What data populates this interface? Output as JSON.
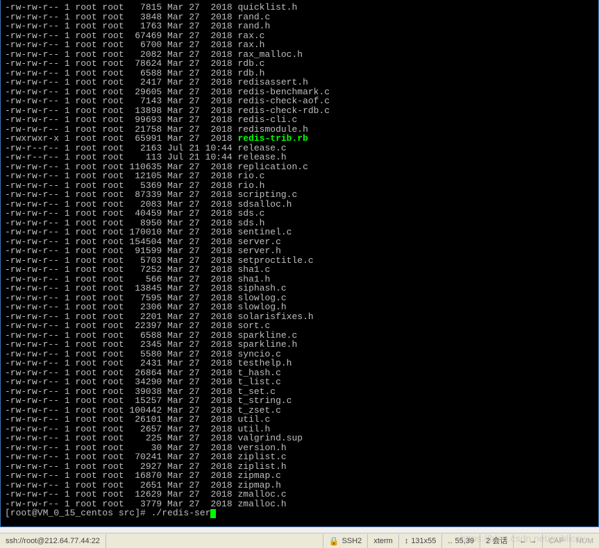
{
  "files": [
    {
      "perm": "-rw-rw-r--",
      "links": "1",
      "owner": "root",
      "group": "root",
      "size": "7815",
      "month": "Mar",
      "day": "27",
      "time": "2018",
      "name": "quicklist.h"
    },
    {
      "perm": "-rw-rw-r--",
      "links": "1",
      "owner": "root",
      "group": "root",
      "size": "3848",
      "month": "Mar",
      "day": "27",
      "time": "2018",
      "name": "rand.c"
    },
    {
      "perm": "-rw-rw-r--",
      "links": "1",
      "owner": "root",
      "group": "root",
      "size": "1763",
      "month": "Mar",
      "day": "27",
      "time": "2018",
      "name": "rand.h"
    },
    {
      "perm": "-rw-rw-r--",
      "links": "1",
      "owner": "root",
      "group": "root",
      "size": "67469",
      "month": "Mar",
      "day": "27",
      "time": "2018",
      "name": "rax.c"
    },
    {
      "perm": "-rw-rw-r--",
      "links": "1",
      "owner": "root",
      "group": "root",
      "size": "6700",
      "month": "Mar",
      "day": "27",
      "time": "2018",
      "name": "rax.h"
    },
    {
      "perm": "-rw-rw-r--",
      "links": "1",
      "owner": "root",
      "group": "root",
      "size": "2082",
      "month": "Mar",
      "day": "27",
      "time": "2018",
      "name": "rax_malloc.h"
    },
    {
      "perm": "-rw-rw-r--",
      "links": "1",
      "owner": "root",
      "group": "root",
      "size": "78624",
      "month": "Mar",
      "day": "27",
      "time": "2018",
      "name": "rdb.c"
    },
    {
      "perm": "-rw-rw-r--",
      "links": "1",
      "owner": "root",
      "group": "root",
      "size": "6588",
      "month": "Mar",
      "day": "27",
      "time": "2018",
      "name": "rdb.h"
    },
    {
      "perm": "-rw-rw-r--",
      "links": "1",
      "owner": "root",
      "group": "root",
      "size": "2417",
      "month": "Mar",
      "day": "27",
      "time": "2018",
      "name": "redisassert.h"
    },
    {
      "perm": "-rw-rw-r--",
      "links": "1",
      "owner": "root",
      "group": "root",
      "size": "29605",
      "month": "Mar",
      "day": "27",
      "time": "2018",
      "name": "redis-benchmark.c"
    },
    {
      "perm": "-rw-rw-r--",
      "links": "1",
      "owner": "root",
      "group": "root",
      "size": "7143",
      "month": "Mar",
      "day": "27",
      "time": "2018",
      "name": "redis-check-aof.c"
    },
    {
      "perm": "-rw-rw-r--",
      "links": "1",
      "owner": "root",
      "group": "root",
      "size": "13898",
      "month": "Mar",
      "day": "27",
      "time": "2018",
      "name": "redis-check-rdb.c"
    },
    {
      "perm": "-rw-rw-r--",
      "links": "1",
      "owner": "root",
      "group": "root",
      "size": "99693",
      "month": "Mar",
      "day": "27",
      "time": "2018",
      "name": "redis-cli.c"
    },
    {
      "perm": "-rw-rw-r--",
      "links": "1",
      "owner": "root",
      "group": "root",
      "size": "21758",
      "month": "Mar",
      "day": "27",
      "time": "2018",
      "name": "redismodule.h"
    },
    {
      "perm": "-rwxrwxr-x",
      "links": "1",
      "owner": "root",
      "group": "root",
      "size": "65991",
      "month": "Mar",
      "day": "27",
      "time": "2018",
      "name": "redis-trib.rb",
      "exec": true
    },
    {
      "perm": "-rw-r--r--",
      "links": "1",
      "owner": "root",
      "group": "root",
      "size": "2163",
      "month": "Jul",
      "day": "21",
      "time": "10:44",
      "name": "release.c"
    },
    {
      "perm": "-rw-r--r--",
      "links": "1",
      "owner": "root",
      "group": "root",
      "size": "113",
      "month": "Jul",
      "day": "21",
      "time": "10:44",
      "name": "release.h"
    },
    {
      "perm": "-rw-rw-r--",
      "links": "1",
      "owner": "root",
      "group": "root",
      "size": "110635",
      "month": "Mar",
      "day": "27",
      "time": "2018",
      "name": "replication.c"
    },
    {
      "perm": "-rw-rw-r--",
      "links": "1",
      "owner": "root",
      "group": "root",
      "size": "12105",
      "month": "Mar",
      "day": "27",
      "time": "2018",
      "name": "rio.c"
    },
    {
      "perm": "-rw-rw-r--",
      "links": "1",
      "owner": "root",
      "group": "root",
      "size": "5369",
      "month": "Mar",
      "day": "27",
      "time": "2018",
      "name": "rio.h"
    },
    {
      "perm": "-rw-rw-r--",
      "links": "1",
      "owner": "root",
      "group": "root",
      "size": "87339",
      "month": "Mar",
      "day": "27",
      "time": "2018",
      "name": "scripting.c"
    },
    {
      "perm": "-rw-rw-r--",
      "links": "1",
      "owner": "root",
      "group": "root",
      "size": "2083",
      "month": "Mar",
      "day": "27",
      "time": "2018",
      "name": "sdsalloc.h"
    },
    {
      "perm": "-rw-rw-r--",
      "links": "1",
      "owner": "root",
      "group": "root",
      "size": "40459",
      "month": "Mar",
      "day": "27",
      "time": "2018",
      "name": "sds.c"
    },
    {
      "perm": "-rw-rw-r--",
      "links": "1",
      "owner": "root",
      "group": "root",
      "size": "8950",
      "month": "Mar",
      "day": "27",
      "time": "2018",
      "name": "sds.h"
    },
    {
      "perm": "-rw-rw-r--",
      "links": "1",
      "owner": "root",
      "group": "root",
      "size": "170010",
      "month": "Mar",
      "day": "27",
      "time": "2018",
      "name": "sentinel.c"
    },
    {
      "perm": "-rw-rw-r--",
      "links": "1",
      "owner": "root",
      "group": "root",
      "size": "154504",
      "month": "Mar",
      "day": "27",
      "time": "2018",
      "name": "server.c"
    },
    {
      "perm": "-rw-rw-r--",
      "links": "1",
      "owner": "root",
      "group": "root",
      "size": "91599",
      "month": "Mar",
      "day": "27",
      "time": "2018",
      "name": "server.h"
    },
    {
      "perm": "-rw-rw-r--",
      "links": "1",
      "owner": "root",
      "group": "root",
      "size": "5703",
      "month": "Mar",
      "day": "27",
      "time": "2018",
      "name": "setproctitle.c"
    },
    {
      "perm": "-rw-rw-r--",
      "links": "1",
      "owner": "root",
      "group": "root",
      "size": "7252",
      "month": "Mar",
      "day": "27",
      "time": "2018",
      "name": "sha1.c"
    },
    {
      "perm": "-rw-rw-r--",
      "links": "1",
      "owner": "root",
      "group": "root",
      "size": "566",
      "month": "Mar",
      "day": "27",
      "time": "2018",
      "name": "sha1.h"
    },
    {
      "perm": "-rw-rw-r--",
      "links": "1",
      "owner": "root",
      "group": "root",
      "size": "13845",
      "month": "Mar",
      "day": "27",
      "time": "2018",
      "name": "siphash.c"
    },
    {
      "perm": "-rw-rw-r--",
      "links": "1",
      "owner": "root",
      "group": "root",
      "size": "7595",
      "month": "Mar",
      "day": "27",
      "time": "2018",
      "name": "slowlog.c"
    },
    {
      "perm": "-rw-rw-r--",
      "links": "1",
      "owner": "root",
      "group": "root",
      "size": "2306",
      "month": "Mar",
      "day": "27",
      "time": "2018",
      "name": "slowlog.h"
    },
    {
      "perm": "-rw-rw-r--",
      "links": "1",
      "owner": "root",
      "group": "root",
      "size": "2201",
      "month": "Mar",
      "day": "27",
      "time": "2018",
      "name": "solarisfixes.h"
    },
    {
      "perm": "-rw-rw-r--",
      "links": "1",
      "owner": "root",
      "group": "root",
      "size": "22397",
      "month": "Mar",
      "day": "27",
      "time": "2018",
      "name": "sort.c"
    },
    {
      "perm": "-rw-rw-r--",
      "links": "1",
      "owner": "root",
      "group": "root",
      "size": "6588",
      "month": "Mar",
      "day": "27",
      "time": "2018",
      "name": "sparkline.c"
    },
    {
      "perm": "-rw-rw-r--",
      "links": "1",
      "owner": "root",
      "group": "root",
      "size": "2345",
      "month": "Mar",
      "day": "27",
      "time": "2018",
      "name": "sparkline.h"
    },
    {
      "perm": "-rw-rw-r--",
      "links": "1",
      "owner": "root",
      "group": "root",
      "size": "5580",
      "month": "Mar",
      "day": "27",
      "time": "2018",
      "name": "syncio.c"
    },
    {
      "perm": "-rw-rw-r--",
      "links": "1",
      "owner": "root",
      "group": "root",
      "size": "2431",
      "month": "Mar",
      "day": "27",
      "time": "2018",
      "name": "testhelp.h"
    },
    {
      "perm": "-rw-rw-r--",
      "links": "1",
      "owner": "root",
      "group": "root",
      "size": "26864",
      "month": "Mar",
      "day": "27",
      "time": "2018",
      "name": "t_hash.c"
    },
    {
      "perm": "-rw-rw-r--",
      "links": "1",
      "owner": "root",
      "group": "root",
      "size": "34290",
      "month": "Mar",
      "day": "27",
      "time": "2018",
      "name": "t_list.c"
    },
    {
      "perm": "-rw-rw-r--",
      "links": "1",
      "owner": "root",
      "group": "root",
      "size": "39038",
      "month": "Mar",
      "day": "27",
      "time": "2018",
      "name": "t_set.c"
    },
    {
      "perm": "-rw-rw-r--",
      "links": "1",
      "owner": "root",
      "group": "root",
      "size": "15257",
      "month": "Mar",
      "day": "27",
      "time": "2018",
      "name": "t_string.c"
    },
    {
      "perm": "-rw-rw-r--",
      "links": "1",
      "owner": "root",
      "group": "root",
      "size": "100442",
      "month": "Mar",
      "day": "27",
      "time": "2018",
      "name": "t_zset.c"
    },
    {
      "perm": "-rw-rw-r--",
      "links": "1",
      "owner": "root",
      "group": "root",
      "size": "26101",
      "month": "Mar",
      "day": "27",
      "time": "2018",
      "name": "util.c"
    },
    {
      "perm": "-rw-rw-r--",
      "links": "1",
      "owner": "root",
      "group": "root",
      "size": "2657",
      "month": "Mar",
      "day": "27",
      "time": "2018",
      "name": "util.h"
    },
    {
      "perm": "-rw-rw-r--",
      "links": "1",
      "owner": "root",
      "group": "root",
      "size": "225",
      "month": "Mar",
      "day": "27",
      "time": "2018",
      "name": "valgrind.sup"
    },
    {
      "perm": "-rw-rw-r--",
      "links": "1",
      "owner": "root",
      "group": "root",
      "size": "30",
      "month": "Mar",
      "day": "27",
      "time": "2018",
      "name": "version.h"
    },
    {
      "perm": "-rw-rw-r--",
      "links": "1",
      "owner": "root",
      "group": "root",
      "size": "70241",
      "month": "Mar",
      "day": "27",
      "time": "2018",
      "name": "ziplist.c"
    },
    {
      "perm": "-rw-rw-r--",
      "links": "1",
      "owner": "root",
      "group": "root",
      "size": "2927",
      "month": "Mar",
      "day": "27",
      "time": "2018",
      "name": "ziplist.h"
    },
    {
      "perm": "-rw-rw-r--",
      "links": "1",
      "owner": "root",
      "group": "root",
      "size": "16870",
      "month": "Mar",
      "day": "27",
      "time": "2018",
      "name": "zipmap.c"
    },
    {
      "perm": "-rw-rw-r--",
      "links": "1",
      "owner": "root",
      "group": "root",
      "size": "2651",
      "month": "Mar",
      "day": "27",
      "time": "2018",
      "name": "zipmap.h"
    },
    {
      "perm": "-rw-rw-r--",
      "links": "1",
      "owner": "root",
      "group": "root",
      "size": "12629",
      "month": "Mar",
      "day": "27",
      "time": "2018",
      "name": "zmalloc.c"
    },
    {
      "perm": "-rw-rw-r--",
      "links": "1",
      "owner": "root",
      "group": "root",
      "size": "3779",
      "month": "Mar",
      "day": "27",
      "time": "2018",
      "name": "zmalloc.h"
    }
  ],
  "prompt": {
    "text": "[root@VM_0_15_centos src]# ",
    "command": "./redis-ser"
  },
  "statusbar": {
    "conn": "ssh://root@212.64.77.44:22",
    "proto": "SSH2",
    "term": "xterm",
    "size": "131x55",
    "pos": "55,39",
    "sessions": "2 会话",
    "cap": "CAP",
    "num": "NUM"
  },
  "watermark": "https://blog.csdn.net/publiccv"
}
